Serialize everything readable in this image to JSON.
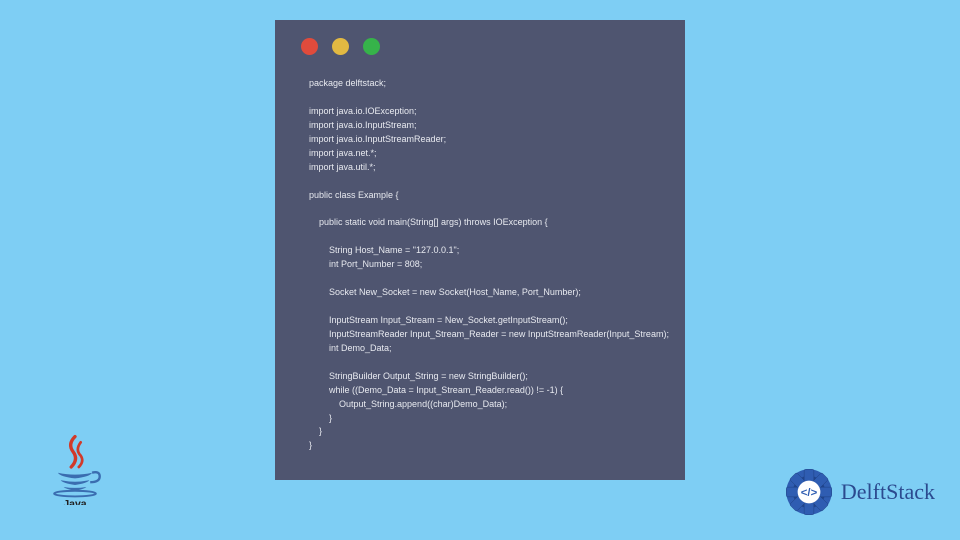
{
  "code_window": {
    "traffic_lights": [
      "red",
      "yellow",
      "green"
    ],
    "code": "package delftstack;\n\nimport java.io.IOException;\nimport java.io.InputStream;\nimport java.io.InputStreamReader;\nimport java.net.*;\nimport java.util.*;\n\npublic class Example {\n\n    public static void main(String[] args) throws IOException {\n\n        String Host_Name = \"127.0.0.1\";\n        int Port_Number = 808;\n\n        Socket New_Socket = new Socket(Host_Name, Port_Number);\n\n        InputStream Input_Stream = New_Socket.getInputStream();\n        InputStreamReader Input_Stream_Reader = new InputStreamReader(Input_Stream);\n        int Demo_Data;\n\n        StringBuilder Output_String = new StringBuilder();\n        while ((Demo_Data = Input_Stream_Reader.read()) != -1) {\n            Output_String.append((char)Demo_Data);\n        }\n    }\n}"
  },
  "logos": {
    "java_label": "Java",
    "delftstack_label": "DelftStack"
  }
}
